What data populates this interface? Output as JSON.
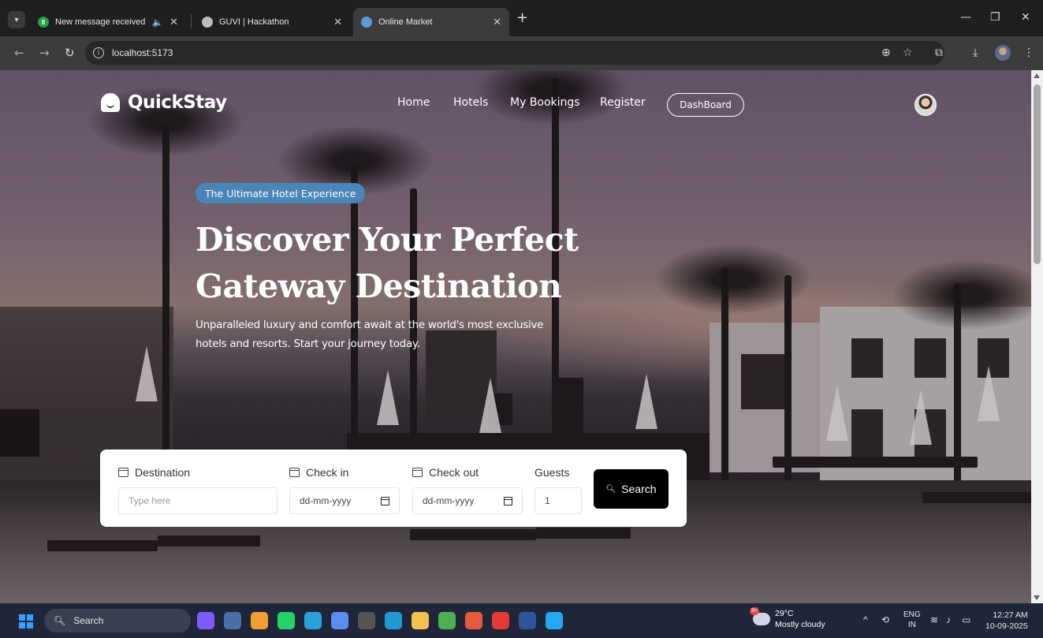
{
  "browser": {
    "tabs": [
      {
        "label": "New message received",
        "favicon_text": "8",
        "favicon_color": "#25a244",
        "audio": true,
        "active": false
      },
      {
        "label": "GUVI | Hackathon",
        "favicon_color": "#bbbbbb",
        "audio": false,
        "active": false
      },
      {
        "label": "Online Market",
        "favicon_color": "#5b9bd5",
        "audio": false,
        "active": true
      }
    ],
    "new_tab_label": "+",
    "url": "localhost:5173"
  },
  "site": {
    "logo_text": "QuickStay",
    "nav": {
      "home": "Home",
      "hotels": "Hotels",
      "my_bookings": "My Bookings",
      "register": "Register",
      "dashboard": "DashBoard"
    },
    "hero": {
      "badge": "The Ultimate Hotel Experience",
      "title_line1": "Discover Your Perfect",
      "title_line2": "Gateway Destination",
      "subtitle_line1": "Unparalleled luxury and comfort await at the world's most exclusive",
      "subtitle_line2": "hotels and resorts. Start your journey today."
    },
    "search_form": {
      "destination_label": "Destination",
      "destination_placeholder": "Type here",
      "checkin_label": "Check in",
      "checkin_value": "dd-mm-yyyy",
      "checkout_label": "Check out",
      "checkout_value": "dd-mm-yyyy",
      "guests_label": "Guests",
      "guests_value": "1",
      "search_button": "Search"
    }
  },
  "taskbar": {
    "search_label": "Search",
    "weather_badge": "9+",
    "weather_temp": "29°C",
    "weather_desc": "Mostly cloudy",
    "lang_top": "ENG",
    "lang_bottom": "IN",
    "time": "12:27 AM",
    "date": "10-09-2025",
    "apps": [
      {
        "name": "copilot-icon",
        "color": "#7c5cff"
      },
      {
        "name": "file-manager-icon",
        "color": "#4a6fa5"
      },
      {
        "name": "infinity-app-icon",
        "color": "#f0a030"
      },
      {
        "name": "whatsapp-icon",
        "color": "#25d366"
      },
      {
        "name": "telegram-icon",
        "color": "#2aa1da"
      },
      {
        "name": "app-icon",
        "color": "#5b8def"
      },
      {
        "name": "chatgpt-icon",
        "color": "#555555"
      },
      {
        "name": "edge-icon",
        "color": "#1d9bd1"
      },
      {
        "name": "folder-icon",
        "color": "#f2c14e"
      },
      {
        "name": "chrome-icon",
        "color": "#4caf50"
      },
      {
        "name": "chrome-profile-icon",
        "color": "#e45b3d"
      },
      {
        "name": "youtube-icon",
        "color": "#e53935"
      },
      {
        "name": "word-icon",
        "color": "#2b579a"
      },
      {
        "name": "vscode-icon",
        "color": "#23a9f2"
      }
    ]
  }
}
